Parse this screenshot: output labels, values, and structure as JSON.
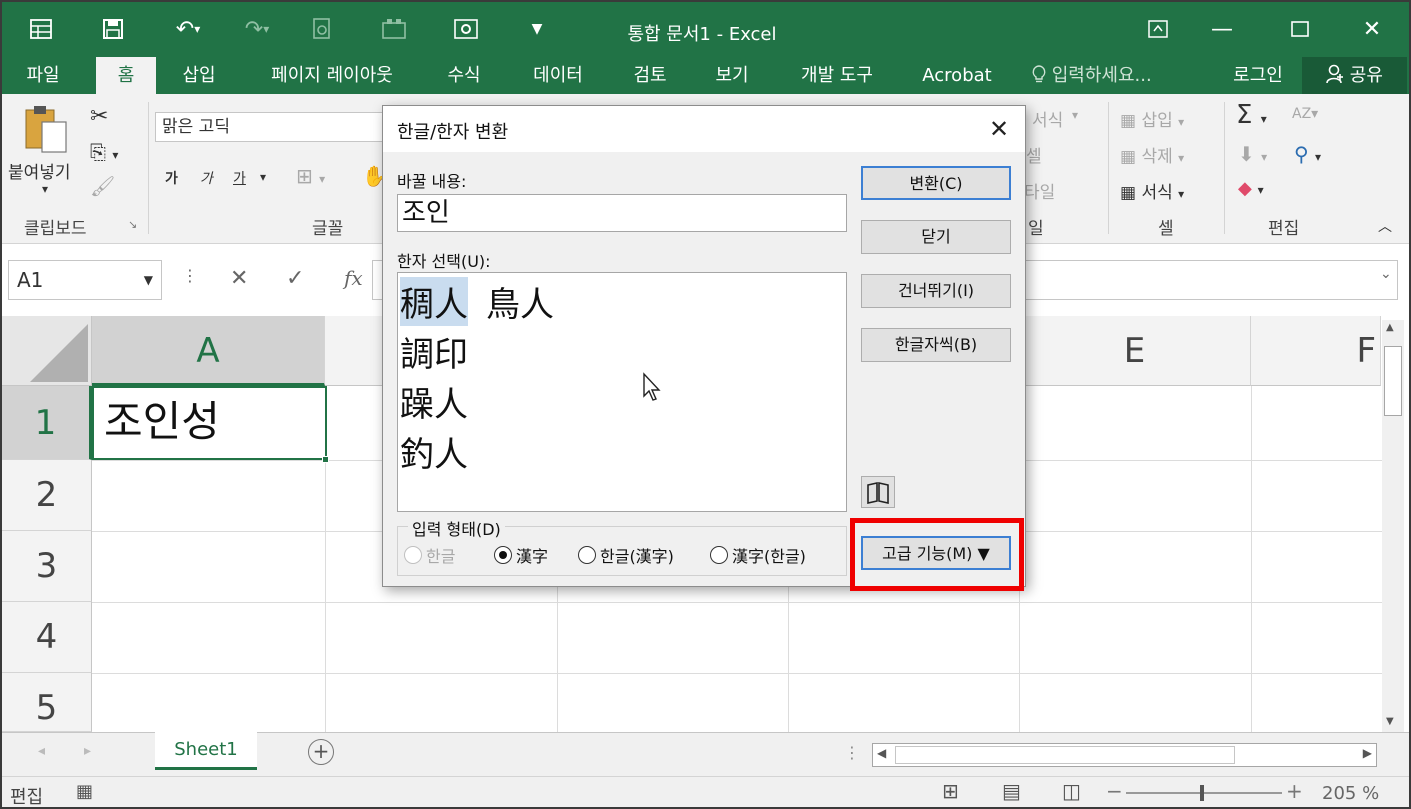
{
  "titlebar": {
    "document_title": "통합 문서1 - Excel"
  },
  "ribbon_tabs": [
    "파일",
    "홈",
    "삽입",
    "페이지 레이아웃",
    "수식",
    "데이터",
    "검토",
    "보기",
    "개발 도구",
    "Acrobat"
  ],
  "tell_me": "입력하세요...",
  "sign_in": "로그인",
  "share": "공유",
  "ribbon": {
    "paste_label": "붙여넣기",
    "clipboard_label": "클립보드",
    "font_name": "맑은 고딕",
    "font_group_label": "글꼴",
    "bold": "가",
    "italic": "가",
    "underline": "가",
    "style_format": "서식",
    "style_cell": "셀",
    "style_fx": "타일",
    "style_group_suffix": "일",
    "cells_insert": "삽입",
    "cells_delete": "삭제",
    "cells_format": "서식",
    "cells_group_label": "셀",
    "edit_group_label": "편집"
  },
  "formula_bar": {
    "name_box": "A1",
    "fx_label": "fx"
  },
  "grid": {
    "columns": [
      "A",
      "E",
      "F"
    ],
    "rows": [
      "1",
      "2",
      "3",
      "4",
      "5"
    ],
    "cell_a1": "조인성"
  },
  "sheet_tab": "Sheet1",
  "status": {
    "mode": "편집",
    "zoom": "205 %"
  },
  "dialog": {
    "title": "한글/한자 변환",
    "replace_label": "바꿀 내용:",
    "replace_value": "조인",
    "hanja_label": "한자 선택(U):",
    "hanja_items": [
      "稠人",
      "鳥人",
      "調印",
      "躁人",
      "釣人"
    ],
    "buttons": {
      "convert": "변환(C)",
      "close": "닫기",
      "skip": "건너뛰기(I)",
      "hangul_char": "한글자씩(B)",
      "advanced": "고급 기능(M) ▼"
    },
    "input_form_label": "입력 형태(D)",
    "radio": {
      "hangul": "한글",
      "hanja": "漢字",
      "hangul_hanja": "한글(漢字)",
      "hanja_hangul": "漢字(한글)"
    }
  },
  "colors": {
    "excel_green": "#217346",
    "highlight_red": "#ef0000",
    "selection_blue": "#c9dcef"
  }
}
